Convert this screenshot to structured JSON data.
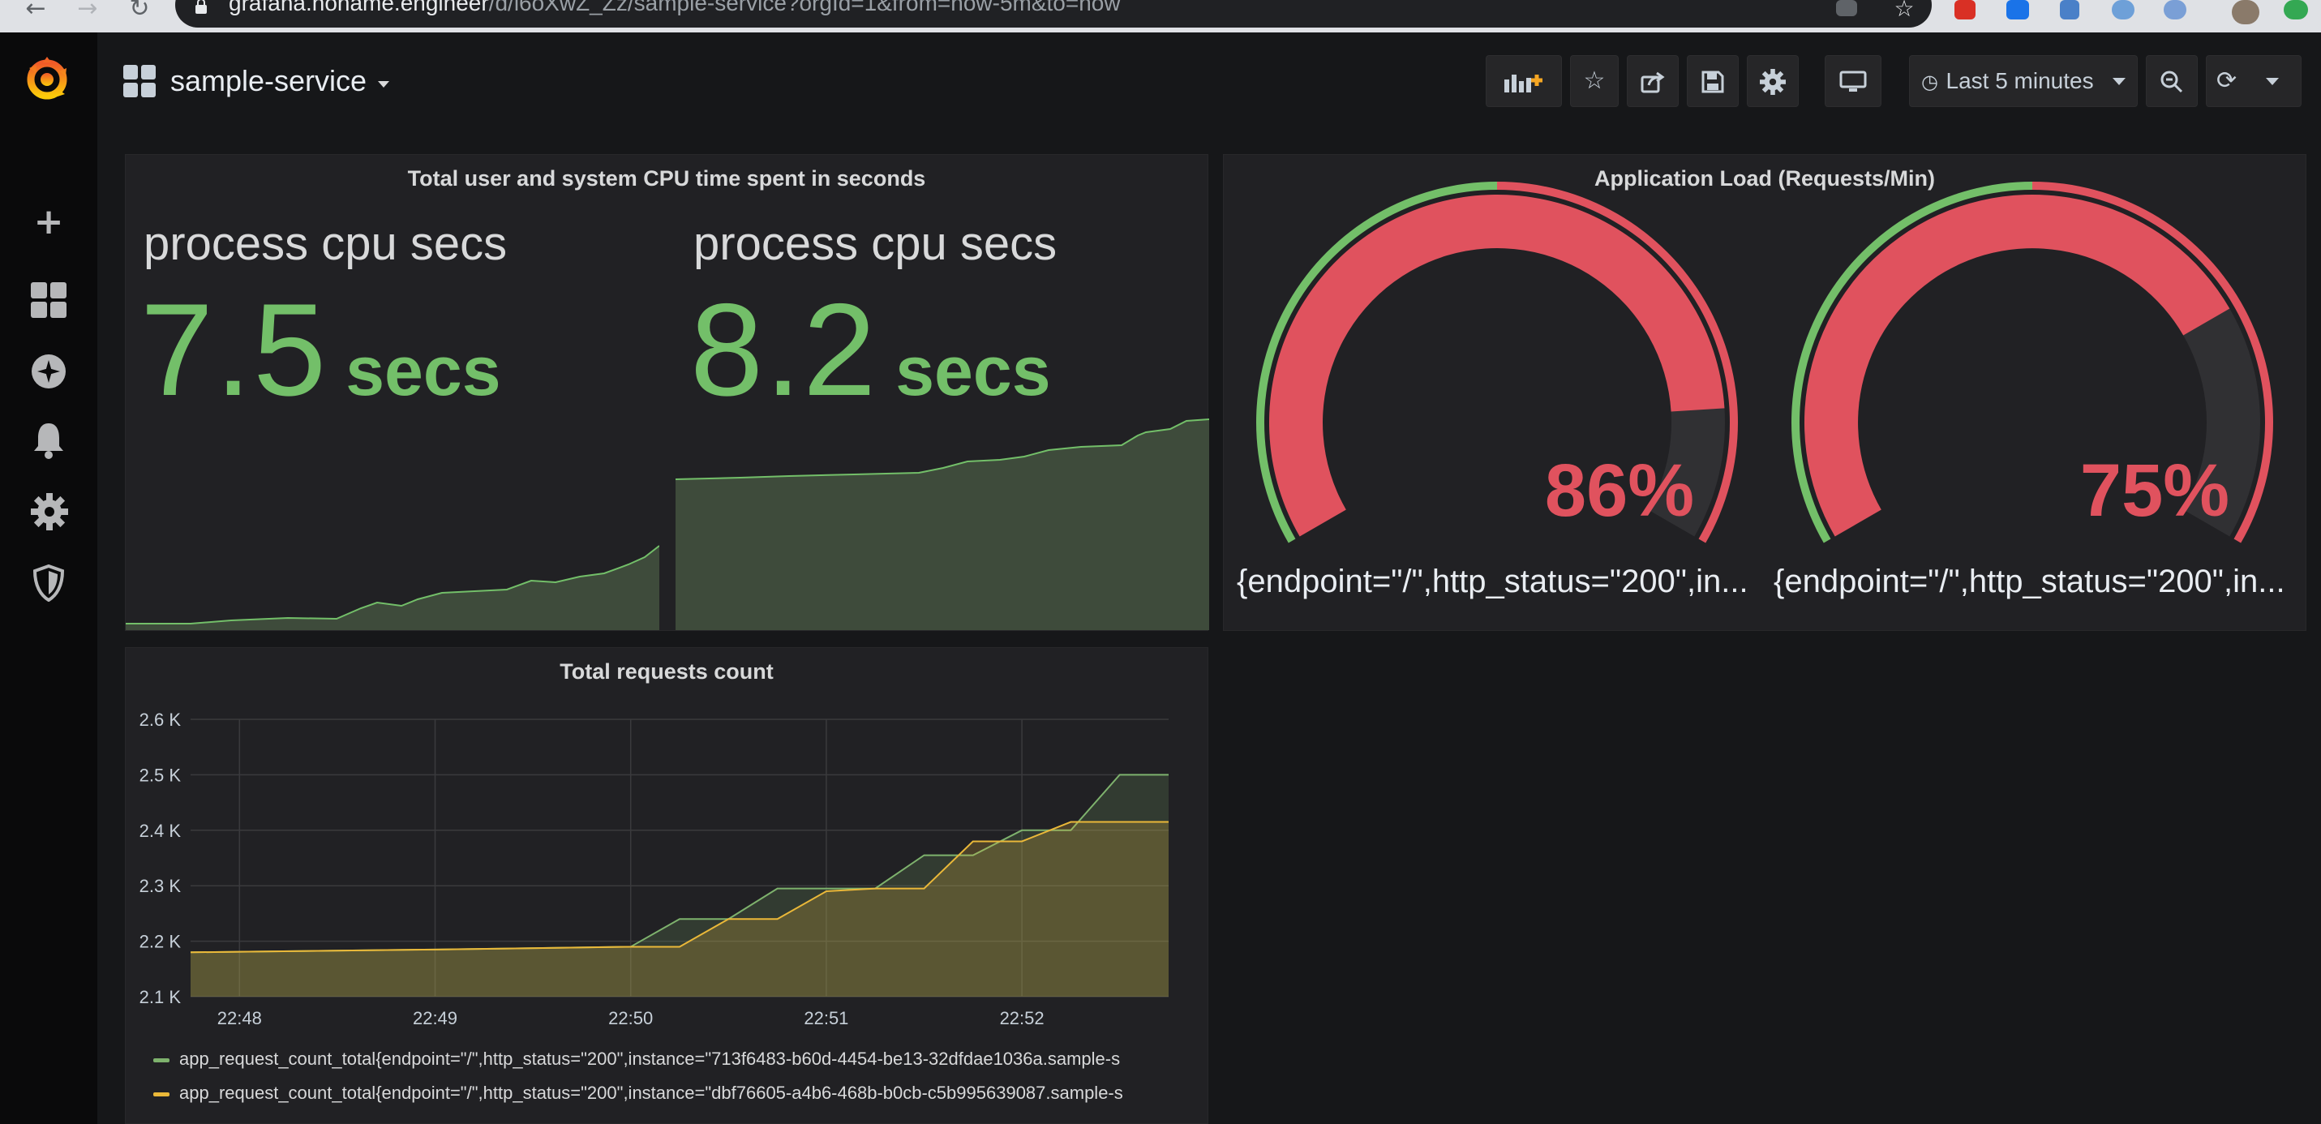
{
  "browser": {
    "url_host": "grafana.noname.engineer",
    "url_path": "/d/l6oXwZ_Zz/sample-service?orgId=1&from=now-5m&to=now"
  },
  "navbar": {
    "dashboard_title": "sample-service",
    "time_range": "Last 5 minutes"
  },
  "side_menu": {
    "items": [
      "grafana-logo-icon",
      "plus-icon",
      "dashboards-icon",
      "explore-icon",
      "alerting-icon",
      "configuration-icon",
      "shield-icon"
    ]
  },
  "panels": {
    "cpu": {
      "title": "Total user and system CPU time spent in seconds",
      "stats": [
        {
          "label": "process cpu secs",
          "value": "7.5",
          "unit": "secs"
        },
        {
          "label": "process cpu secs",
          "value": "8.2",
          "unit": "secs"
        }
      ]
    },
    "load": {
      "title": "Application Load (Requests/Min)",
      "gauges": [
        {
          "value": "86%",
          "percent": 86,
          "label": "{endpoint=\"/\",http_status=\"200\",in..."
        },
        {
          "value": "75%",
          "percent": 75,
          "label": "{endpoint=\"/\",http_status=\"200\",in..."
        }
      ]
    },
    "requests": {
      "title": "Total requests count",
      "legend": [
        {
          "text": "app_request_count_total{endpoint=\"/\",http_status=\"200\",instance=\"713f6483-b60d-4454-be13-32dfdae1036a.sample-s",
          "color": "#7eb26d"
        },
        {
          "text": "app_request_count_total{endpoint=\"/\",http_status=\"200\",instance=\"dbf76605-a4b6-468b-b0cb-c5b995639087.sample-s",
          "color": "#eab839"
        }
      ]
    }
  },
  "colors": {
    "green": "#73bf69",
    "red": "#e0525e",
    "yellow": "#eab839",
    "panel_bg": "#212124"
  },
  "chart_data": {
    "type": "line",
    "title": "Total requests count",
    "y_ticks": [
      "2.1 K",
      "2.2 K",
      "2.3 K",
      "2.4 K",
      "2.5 K",
      "2.6 K"
    ],
    "x_ticks": [
      "22:48",
      "22:49",
      "22:50",
      "22:51",
      "22:52"
    ],
    "ylim": [
      2100,
      2600
    ],
    "x_range": [
      "22:47:45",
      "22:52:45"
    ],
    "grid": true,
    "legend_position": "bottom",
    "x": [
      "22:47:45",
      "22:48",
      "22:49",
      "22:50",
      "22:50:15",
      "22:50:30",
      "22:50:45",
      "22:51",
      "22:51:15",
      "22:51:30",
      "22:51:45",
      "22:52",
      "22:52:15",
      "22:52:30",
      "22:52:45"
    ],
    "series": [
      {
        "values": [
          2180,
          2181,
          2185,
          2190,
          2240,
          2240,
          2295,
          2295,
          2295,
          2355,
          2355,
          2400,
          2400,
          2500,
          2500
        ]
      },
      {
        "values": [
          2180,
          2181,
          2185,
          2190,
          2190,
          2240,
          2240,
          2290,
          2295,
          2295,
          2380,
          2380,
          2415,
          2415,
          2415
        ]
      }
    ]
  }
}
